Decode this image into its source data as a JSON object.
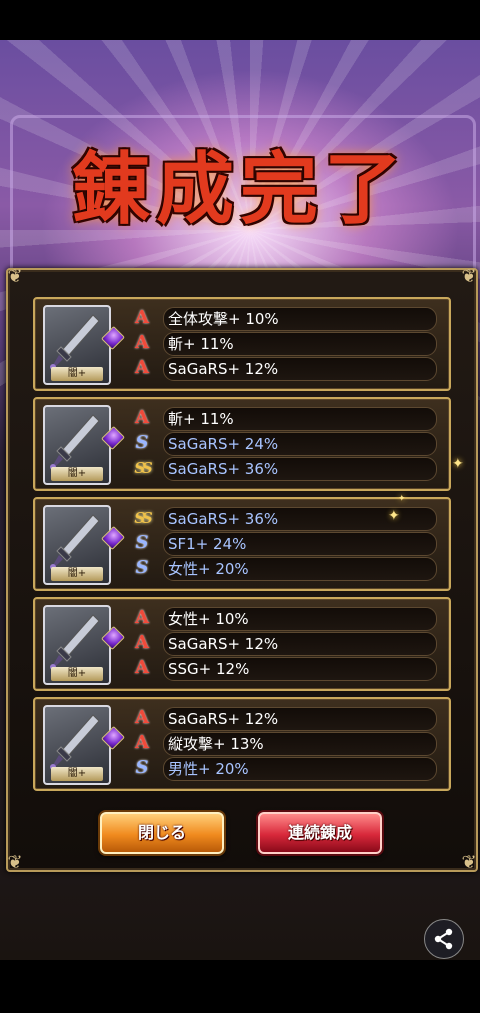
{
  "title": "錬成完了",
  "weapon_tag": "闇+",
  "cards": [
    {
      "rows": [
        {
          "icon": "A",
          "type": "a",
          "text": "全体攻撃+ 10%"
        },
        {
          "icon": "A",
          "type": "a",
          "text": "斬+ 11%"
        },
        {
          "icon": "A",
          "type": "a",
          "text": "SaGaRS+ 12%"
        }
      ]
    },
    {
      "rows": [
        {
          "icon": "A",
          "type": "a",
          "text": "斬+ 11%"
        },
        {
          "icon": "S",
          "type": "s",
          "text": "SaGaRS+ 24%"
        },
        {
          "icon": "SS",
          "type": "ss",
          "text": "SaGaRS+ 36%"
        }
      ]
    },
    {
      "rows": [
        {
          "icon": "SS",
          "type": "ss",
          "text": "SaGaRS+ 36%"
        },
        {
          "icon": "S",
          "type": "s",
          "text": "SF1+ 24%"
        },
        {
          "icon": "S",
          "type": "s",
          "text": "女性+ 20%"
        }
      ]
    },
    {
      "rows": [
        {
          "icon": "A",
          "type": "a",
          "text": "女性+ 10%"
        },
        {
          "icon": "A",
          "type": "a",
          "text": "SaGaRS+ 12%"
        },
        {
          "icon": "A",
          "type": "a",
          "text": "SSG+ 12%"
        }
      ]
    },
    {
      "rows": [
        {
          "icon": "A",
          "type": "a",
          "text": "SaGaRS+ 12%"
        },
        {
          "icon": "A",
          "type": "a",
          "text": "縦攻撃+ 13%"
        },
        {
          "icon": "S",
          "type": "s",
          "text": "男性+ 20%"
        }
      ]
    }
  ],
  "buttons": {
    "close": "閉じる",
    "continuous": "連続錬成"
  },
  "icons": {
    "share": "share-icon",
    "weapon": "sword-icon",
    "rank_a": "rank-a-icon",
    "rank_s": "rank-s-icon",
    "rank_ss": "rank-ss-icon"
  }
}
